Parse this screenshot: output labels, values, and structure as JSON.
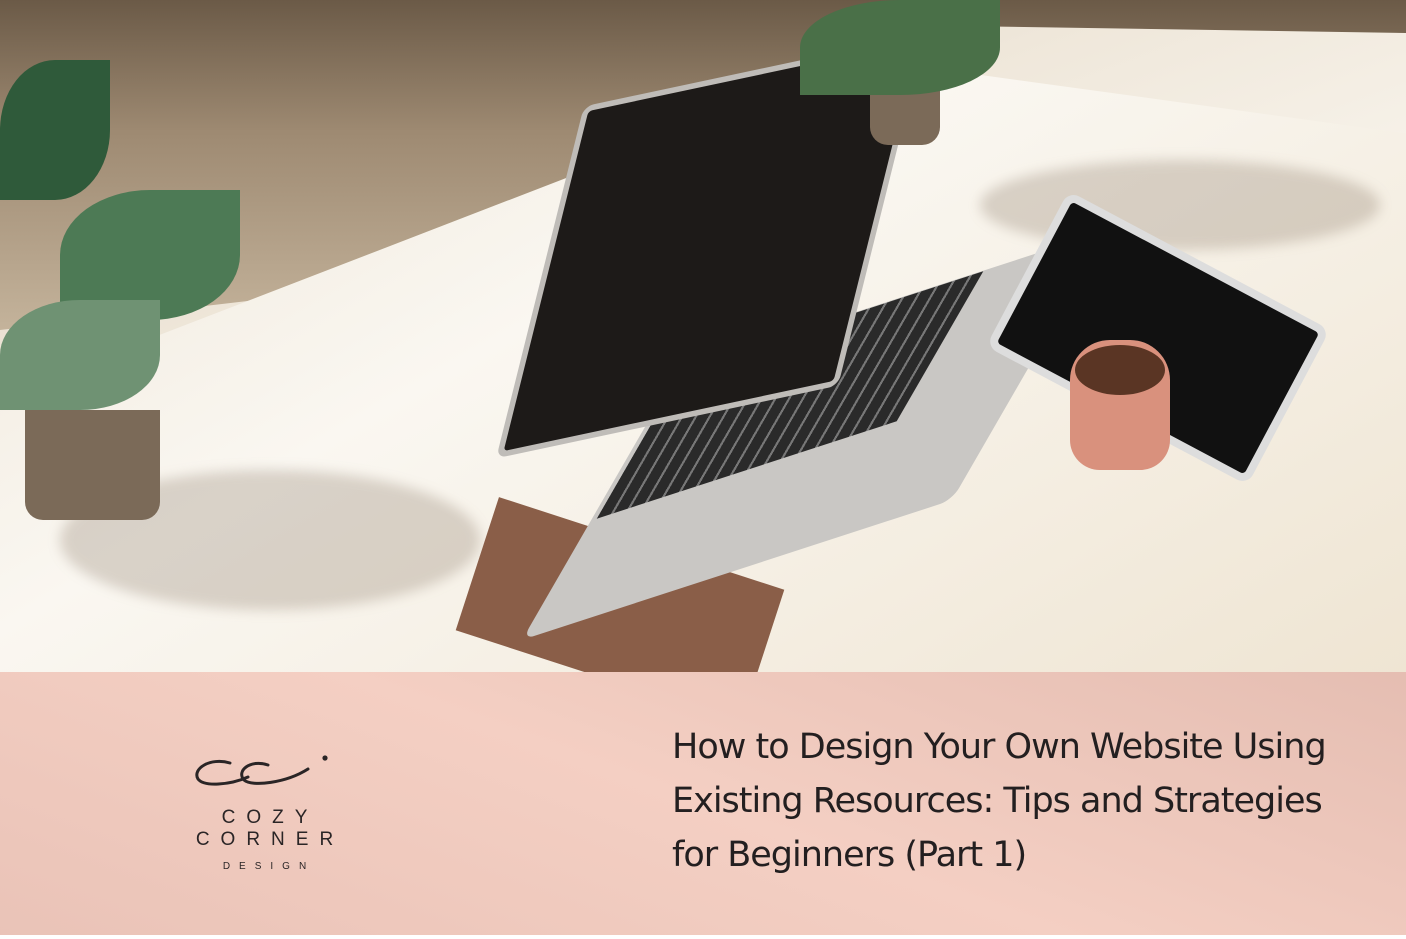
{
  "banner": {
    "title": "How to Design Your Own Website Using Existing Resources: Tips and Strategies for Beginners (Part 1)",
    "band_color": "#f4cfc3"
  },
  "logo": {
    "monogram": "cci",
    "brand": "COZY CORNER",
    "subtitle": "DESIGN"
  }
}
